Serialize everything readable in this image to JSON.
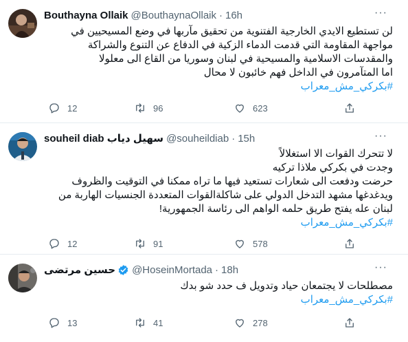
{
  "tweets": [
    {
      "name": "Bouthayna Ollaik",
      "handle": "@BouthaynaOllaik",
      "time": "16h",
      "verified": false,
      "lines": [
        "لن تستطيع الايدي الخارجية الفتنوية من تحقيق مآربها في وضع المسيحيين في",
        "مواجهة المقاومة التي قدمت الدماء الزكية في الدفاع عن التنوع والشراكة",
        "والمقدسات الاسلامية والمسيحية في لبنان وسوريا من القاع الى معلولا",
        "اما المتآمرون في الداخل فهم خائبون لا محال"
      ],
      "hashtag": "#بكركي_مش_معراب",
      "replies": "12",
      "retweets": "96",
      "likes": "623"
    },
    {
      "name": "souheil diab سهيل دياب",
      "handle": "@souheildiab",
      "time": "15h",
      "verified": false,
      "lines": [
        "لا تتحرك القوات الا استغلالاً",
        "وجدت  في بكركي ملاذا تركيه",
        "حرضت ودفعت الى شعارات تستعيد فيها ما تراه ممكنا في التوقيت والظروف",
        "ويدغدغها مشهد التدخل الدولي على شاكلةالقوات المتعددة الجنسيات الهاربة من",
        "لبنان عله يفتح طريق حلمه الواهم الى رئاسة الجمهورية!"
      ],
      "hashtag": "#بكركي_مش_معراب",
      "replies": "12",
      "retweets": "91",
      "likes": "578"
    },
    {
      "name": "حسين مرتضى",
      "handle": "@HoseinMortada",
      "time": "18h",
      "verified": true,
      "lines": [
        "مصطلحات لا يجتمعان حياد وتدويل ف حدد شو بدك"
      ],
      "hashtag": "#بكركي_مش_معراب",
      "replies": "13",
      "retweets": "41",
      "likes": "278"
    }
  ],
  "icons": {
    "reply": "reply-icon",
    "retweet": "retweet-icon",
    "like": "like-icon",
    "share": "share-icon",
    "more": "more-icon",
    "verified": "verified-badge-icon"
  },
  "colors": {
    "text": "#0f1419",
    "muted": "#536471",
    "link": "#1d9bf0",
    "divider": "#e6ecf0"
  },
  "more_glyph": "···"
}
